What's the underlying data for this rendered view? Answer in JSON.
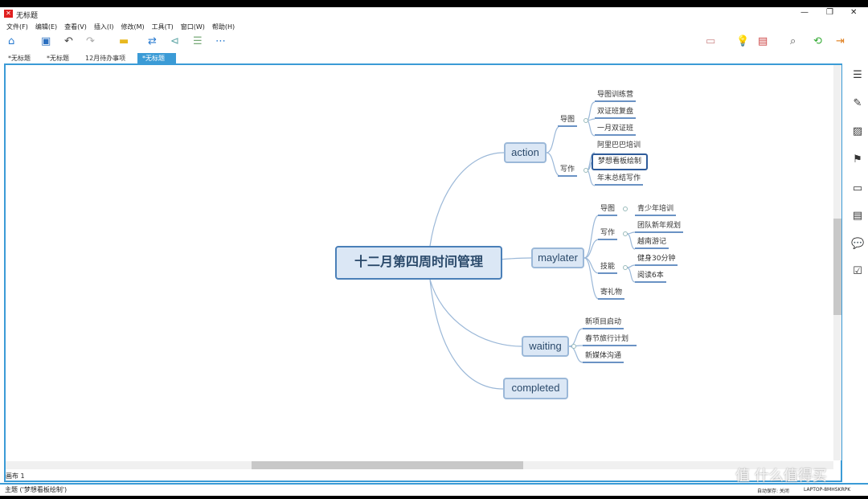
{
  "window": {
    "title": "无标题",
    "controls": [
      "—",
      "❐",
      "✕"
    ]
  },
  "menu": [
    "文件(F)",
    "编辑(E)",
    "查看(V)",
    "插入(I)",
    "修改(M)",
    "工具(T)",
    "窗口(W)",
    "帮助(H)"
  ],
  "tabs": [
    {
      "label": "*无标题"
    },
    {
      "label": "*无标题"
    },
    {
      "label": "12月待办事项"
    },
    {
      "label": "*无标题",
      "active": true,
      "close": "✕"
    }
  ],
  "mindmap": {
    "root": "十二月第四周时间管理",
    "branches": [
      {
        "label": "action",
        "children": [
          {
            "label": "导图",
            "children": [
              "导图训练营",
              "双证班复盘",
              "一月双证班"
            ]
          },
          {
            "label": "写作",
            "children": [
              "阿里巴巴培训",
              "梦想看板绘制",
              "年末总结写作"
            ]
          }
        ]
      },
      {
        "label": "maylater",
        "children": [
          {
            "label": "导图",
            "children": [
              "青少年培训"
            ]
          },
          {
            "label": "写作",
            "children": [
              "团队新年规划",
              "越南游记"
            ]
          },
          {
            "label": "技能",
            "children": [
              "健身30分钟",
              "阅读6本"
            ]
          },
          {
            "label": "寄礼物",
            "children": []
          }
        ]
      },
      {
        "label": "waiting",
        "children": [
          "新项目启动",
          "春节旅行计划",
          "新媒体沟通"
        ]
      },
      {
        "label": "completed",
        "children": []
      }
    ],
    "selected": "梦想看板绘制"
  },
  "sheet_tab": "画布 1",
  "status": {
    "left": "主题 ('梦想看板绘制')",
    "autosave": "自动保存: 关闭",
    "computer": "LAPTOP-8MHSKRPK"
  },
  "watermark": "值 什么值得买",
  "accent": "#3b9bd6"
}
